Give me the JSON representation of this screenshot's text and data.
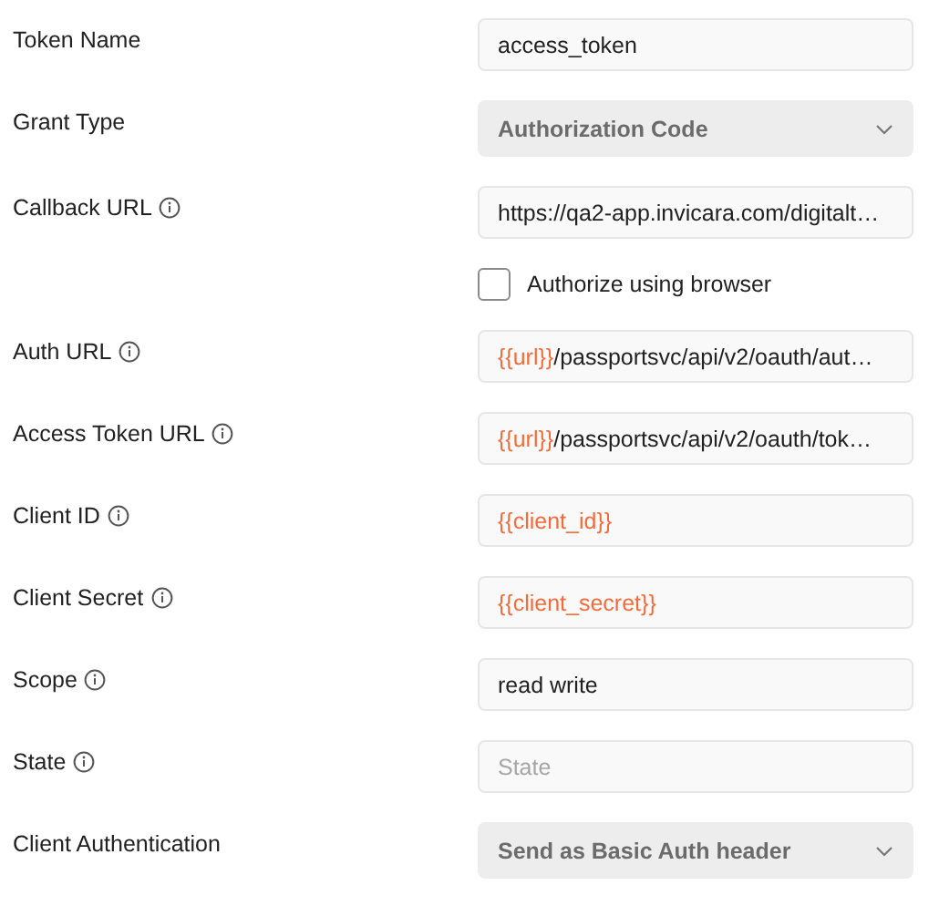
{
  "rows": [
    {
      "kind": "text",
      "label": "Token Name",
      "info": false,
      "value": [
        {
          "text": "access_token",
          "variable": false
        }
      ]
    },
    {
      "kind": "select",
      "label": "Grant Type",
      "info": false,
      "value": [
        {
          "text": "Authorization Code",
          "variable": false
        }
      ]
    },
    {
      "kind": "text",
      "label": "Callback URL",
      "info": true,
      "value": [
        {
          "text": "https://qa2-app.invicara.com/digitalt…",
          "variable": false
        }
      ]
    },
    {
      "kind": "checkbox",
      "label": "Authorize using browser",
      "checked": false
    },
    {
      "kind": "text",
      "label": "Auth URL",
      "info": true,
      "value": [
        {
          "text": "{{url}}",
          "variable": true
        },
        {
          "text": "/passportsvc/api/v2/oauth/aut…",
          "variable": false
        }
      ]
    },
    {
      "kind": "text",
      "label": "Access Token URL",
      "info": true,
      "value": [
        {
          "text": "{{url}}",
          "variable": true
        },
        {
          "text": "/passportsvc/api/v2/oauth/tok…",
          "variable": false
        }
      ]
    },
    {
      "kind": "text",
      "label": "Client ID",
      "info": true,
      "value": [
        {
          "text": "{{client_id}}",
          "variable": true
        }
      ]
    },
    {
      "kind": "text",
      "label": "Client Secret",
      "info": true,
      "value": [
        {
          "text": "{{client_secret}}",
          "variable": true
        }
      ]
    },
    {
      "kind": "text",
      "label": "Scope",
      "info": true,
      "value": [
        {
          "text": "read write",
          "variable": false
        }
      ]
    },
    {
      "kind": "text",
      "label": "State",
      "info": true,
      "placeholder": "State"
    },
    {
      "kind": "select",
      "label": "Client Authentication",
      "info": false,
      "value": [
        {
          "text": "Send as Basic Auth header",
          "variable": false
        }
      ]
    }
  ]
}
